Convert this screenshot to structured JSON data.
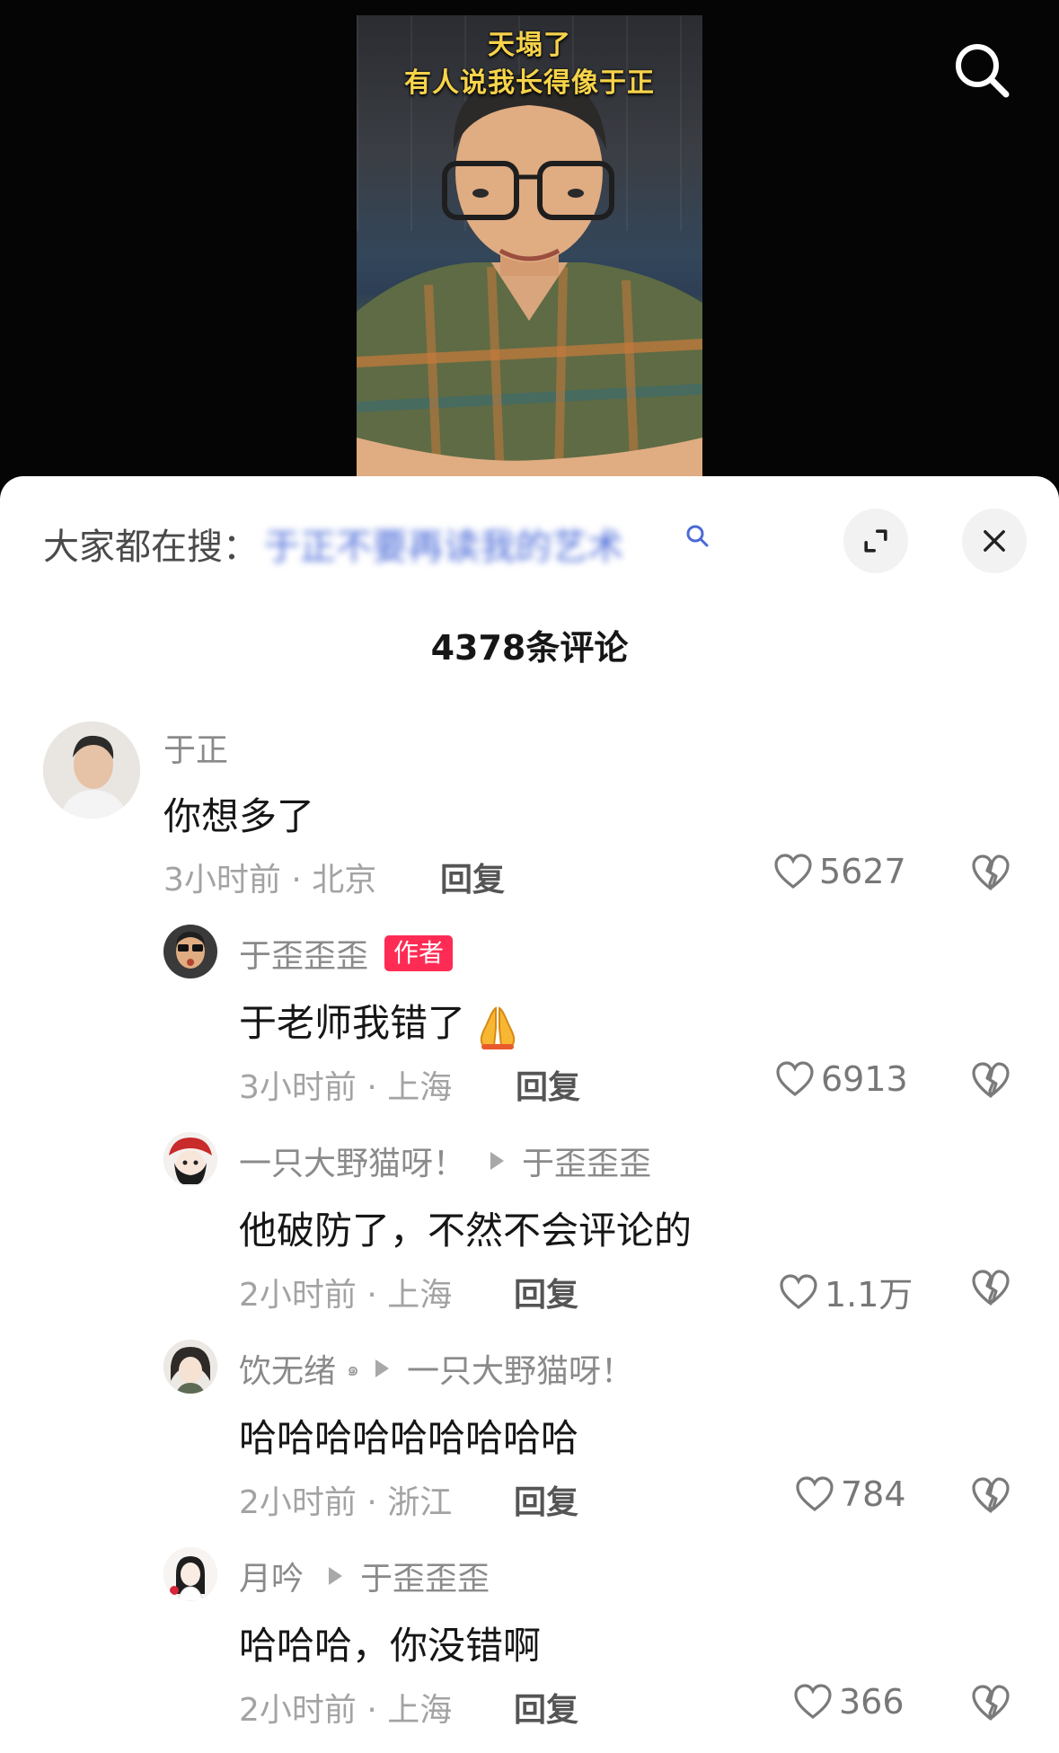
{
  "video": {
    "overlay_line1": "天塌了",
    "overlay_line2": "有人说我长得像于正"
  },
  "sheet": {
    "search_prefix": "大家都在搜：",
    "search_query": "于正不要再读我的艺术",
    "comment_count": "4378条评论"
  },
  "comments": [
    {
      "name": "于正",
      "text": "你想多了",
      "meta": "3小时前 · 北京",
      "reply": "回复",
      "likes": "5627"
    },
    {
      "name": "于歪歪歪",
      "badge": "作者",
      "text": "于老师我错了",
      "meta": "3小时前 · 上海",
      "reply": "回复",
      "likes": "6913"
    },
    {
      "name": "一只大野猫呀！",
      "reply_to": "于歪歪歪",
      "text": "他破防了，不然不会评论的",
      "meta": "2小时前 · 上海",
      "reply": "回复",
      "likes": "1.1万"
    },
    {
      "name": "饮无绪",
      "verified": "๑",
      "reply_to": "一只大野猫呀！",
      "text": "哈哈哈哈哈哈哈哈哈",
      "meta": "2小时前 · 浙江",
      "reply": "回复",
      "likes": "784"
    },
    {
      "name": "月吟",
      "reply_to": "于歪歪歪",
      "text": "哈哈哈，你没错啊",
      "meta": "2小时前 · 上海",
      "reply": "回复",
      "likes": "366"
    }
  ],
  "icons": {
    "search": "search-icon",
    "expand": "expand-icon",
    "close": "close-icon",
    "like": "heart-outline-icon",
    "dislike": "broken-heart-icon",
    "pray": "praying-hands-emoji"
  },
  "colors": {
    "overlay_text": "#f7d34a",
    "author_badge": "#fe2c55",
    "meta_gray": "#a3a3a3"
  }
}
